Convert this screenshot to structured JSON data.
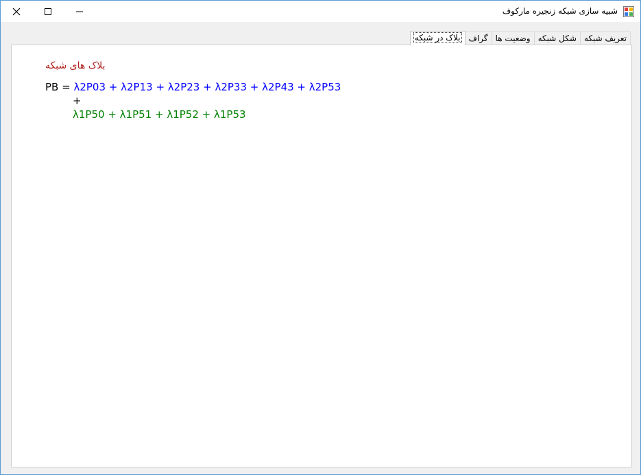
{
  "window": {
    "title": "شبیه سازی شبکه زنجیره مارکوف",
    "controls": {
      "close": "✕",
      "maximize": "☐",
      "minimize": "—"
    }
  },
  "tabs": [
    {
      "label": "تعریف شبکه",
      "active": false
    },
    {
      "label": "شکل شبکه",
      "active": false
    },
    {
      "label": "وضعیت ها",
      "active": false
    },
    {
      "label": "گراف",
      "active": false
    },
    {
      "label": "بلاک در شبکه",
      "active": true
    }
  ],
  "panel": {
    "heading": "بلاک های شبکه",
    "equation": {
      "lhs": "PB =",
      "line1": "λ2P03 + λ2P13 + λ2P23 + λ2P33 + λ2P43 + λ2P53",
      "plus": "+",
      "line2": "λ1P50 + λ1P51 + λ1P52 + λ1P53"
    }
  },
  "colors": {
    "heading": "#b22222",
    "line1": "#0000ff",
    "line2": "#008000",
    "window_border": "#5a9bd4"
  }
}
